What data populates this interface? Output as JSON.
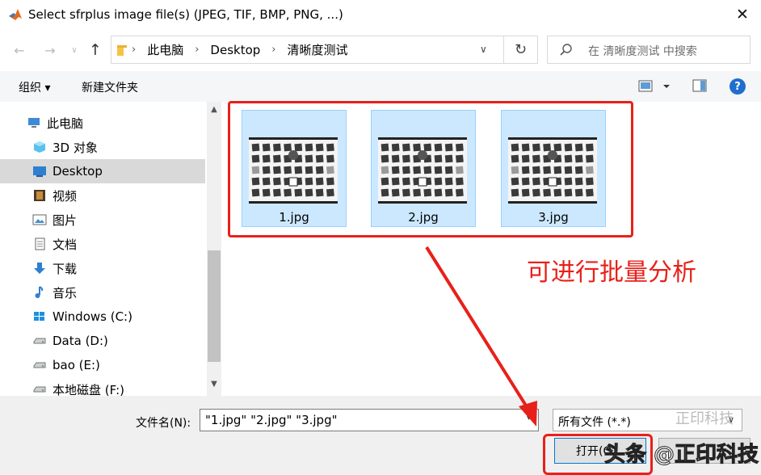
{
  "window": {
    "title": "Select sfrplus image file(s) (JPEG, TIF, BMP, PNG, ...)",
    "close_label": "✕"
  },
  "address": {
    "crumbs": [
      "此电脑",
      "Desktop",
      "清晰度测试"
    ],
    "crumb_separator": "›"
  },
  "search": {
    "placeholder": "在 清晰度测试 中搜索"
  },
  "toolbar": {
    "organize_label": "组织 ▾",
    "new_folder_label": "新建文件夹",
    "help_label": "?"
  },
  "sidebar": {
    "items": [
      {
        "label": "此电脑",
        "icon": "computer-icon"
      },
      {
        "label": "3D 对象",
        "icon": "3d-objects-icon"
      },
      {
        "label": "Desktop",
        "icon": "desktop-icon",
        "selected": true
      },
      {
        "label": "视频",
        "icon": "video-icon"
      },
      {
        "label": "图片",
        "icon": "pictures-icon"
      },
      {
        "label": "文档",
        "icon": "documents-icon"
      },
      {
        "label": "下载",
        "icon": "download-icon"
      },
      {
        "label": "音乐",
        "icon": "music-icon"
      },
      {
        "label": "Windows (C:)",
        "icon": "windows-drive-icon"
      },
      {
        "label": "Data (D:)",
        "icon": "drive-icon"
      },
      {
        "label": "bao (E:)",
        "icon": "drive-icon"
      },
      {
        "label": "本地磁盘 (F:)",
        "icon": "drive-icon"
      }
    ]
  },
  "files": [
    {
      "name": "1.jpg",
      "selected": true
    },
    {
      "name": "2.jpg",
      "selected": true
    },
    {
      "name": "3.jpg",
      "selected": true
    }
  ],
  "annotation": {
    "text": "可进行批量分析",
    "color": "#e8201a"
  },
  "bottom": {
    "filename_label": "文件名(N):",
    "filename_value": "\"1.jpg\" \"2.jpg\" \"3.jpg\"",
    "filetype_value": "所有文件 (*.*)",
    "open_label": "打开(O)"
  },
  "watermark": {
    "text_top": "正印科技",
    "text_main": "头条 @正印科技"
  },
  "colors": {
    "accent": "#0078d7",
    "selection": "#cce8ff",
    "annotation_red": "#e8201a"
  }
}
